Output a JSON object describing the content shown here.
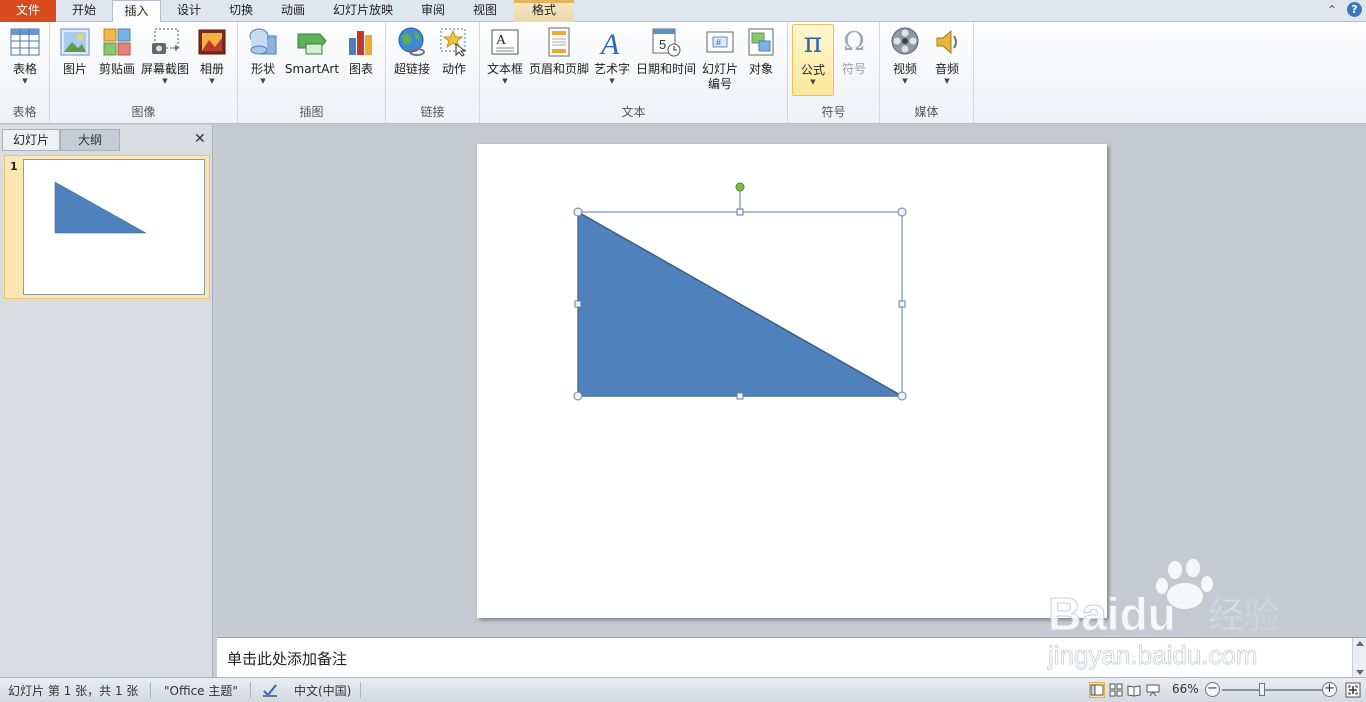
{
  "tabs": [
    {
      "label": "文件",
      "state": "file"
    },
    {
      "label": "开始",
      "state": "normal"
    },
    {
      "label": "插入",
      "state": "active"
    },
    {
      "label": "设计",
      "state": "normal"
    },
    {
      "label": "切换",
      "state": "normal"
    },
    {
      "label": "动画",
      "state": "normal"
    },
    {
      "label": "幻灯片放映",
      "state": "normal"
    },
    {
      "label": "审阅",
      "state": "normal"
    },
    {
      "label": "视图",
      "state": "normal"
    },
    {
      "label": "格式",
      "state": "context"
    }
  ],
  "window": {
    "minimize_ribbon_glyph": "⌃",
    "help_glyph": "?"
  },
  "ribbon": {
    "groups": {
      "tables": "表格",
      "images": "图像",
      "illustrations": "插图",
      "links": "链接",
      "text": "文本",
      "symbols": "符号",
      "media": "媒体"
    },
    "buttons": {
      "table": "表格",
      "picture": "图片",
      "clipart": "剪贴画",
      "screenshot": "屏幕截图",
      "album": "相册",
      "shapes": "形状",
      "smartart": "SmartArt",
      "chart": "图表",
      "hyperlink": "超链接",
      "action": "动作",
      "textbox": "文本框",
      "header_footer": "页眉和页脚",
      "wordart": "艺术字",
      "datetime": "日期和时间",
      "slide_number_1": "幻灯片",
      "slide_number_2": "编号",
      "object": "对象",
      "equation": "公式",
      "symbol": "符号",
      "video": "视频",
      "audio": "音频"
    },
    "equation_glyph": "π",
    "symbol_glyph": "Ω",
    "wordart_glyph": "A",
    "textbox_glyph": "A",
    "datetime_glyph": "5",
    "slide_number_glyph": "#"
  },
  "left_panel": {
    "tab_slides": "幻灯片",
    "tab_outline": "大纲",
    "close_glyph": "✕",
    "slide_number": "1"
  },
  "notes": {
    "placeholder": "单击此处添加备注"
  },
  "status": {
    "slide_info": "幻灯片 第 1 张，共 1 张",
    "theme": "\"Office 主题\"",
    "language": "中文(中国)",
    "zoom": "66%",
    "zoom_fraction": 0.4,
    "zoom_minus": "−",
    "zoom_plus": "+"
  },
  "watermark": {
    "brand": "Baidu",
    "brand_cn": "经验",
    "url": "jingyan.baidu.com"
  },
  "colors": {
    "accent_file_tab": "#d84b1c",
    "shape_fill": "#4f81bd",
    "shape_stroke": "#385d8a",
    "selected_button": "#fde89b",
    "rotation_handle": "#7ac143"
  }
}
